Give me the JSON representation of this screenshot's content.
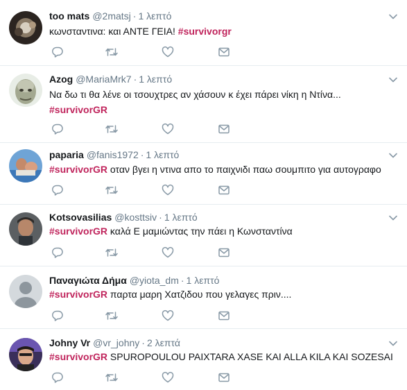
{
  "icons": {
    "reply": "reply-icon",
    "retweet": "retweet-icon",
    "like": "heart-icon",
    "dm": "envelope-icon",
    "more": "chevron-down-icon"
  },
  "colors": {
    "hashtag": "#c0245c",
    "muted": "#657786",
    "icon": "#8899a6",
    "border": "#e6ecf0"
  },
  "tweets": [
    {
      "name": "too mats",
      "handle": "@2matsj",
      "dot": "·",
      "time": "1 λεπτό",
      "line1_text": "κωνσταντινα: και  ΑΝΤΕ ΓΕΙΑ! ",
      "line1_hashtag": "#survivorgr",
      "line2_hashtag": ""
    },
    {
      "name": "Azog",
      "handle": "@MariaMrk7",
      "dot": "·",
      "time": "1 λεπτό",
      "line1_text": "Να δω τι θα λένε οι τσουχτρες αν χάσουν κ έχει πάρει νίκη η Ντίνα...",
      "line2_hashtag": "#survivorGR"
    },
    {
      "name": "paparia",
      "handle": "@fanis1972",
      "dot": "·",
      "time": "1 λεπτό",
      "line1_hashtag": "#survivorGR",
      "line1_text": "  οταν βγει η ντινα απο το παιχνιδι παω σουμπιτο για αυτογραφο"
    },
    {
      "name": "Kotsovasilias",
      "handle": "@kosttsiv",
      "dot": "·",
      "time": "1 λεπτό",
      "line1_hashtag": "#survivorGR",
      "line1_text": " καλά Ε μαμιώντας την πάει η Κωνσταντίνα"
    },
    {
      "name": "Παναγιώτα Δήμα",
      "handle": "@yiota_dm",
      "dot": "·",
      "time": "1 λεπτό",
      "line1_hashtag": "#survivorGR",
      "line1_text": " παρτα μαρη Χατζιδου που γελαγες πριν...."
    },
    {
      "name": "Johny Vr",
      "handle": "@vr_johny",
      "dot": "·",
      "time": "2 λεπτά",
      "line1_hashtag": "#survivorGR",
      "line1_text": "  SPUROPOULOU PAIXTARA XASE KAI ALLA KILA KAI SOZESAI"
    }
  ]
}
